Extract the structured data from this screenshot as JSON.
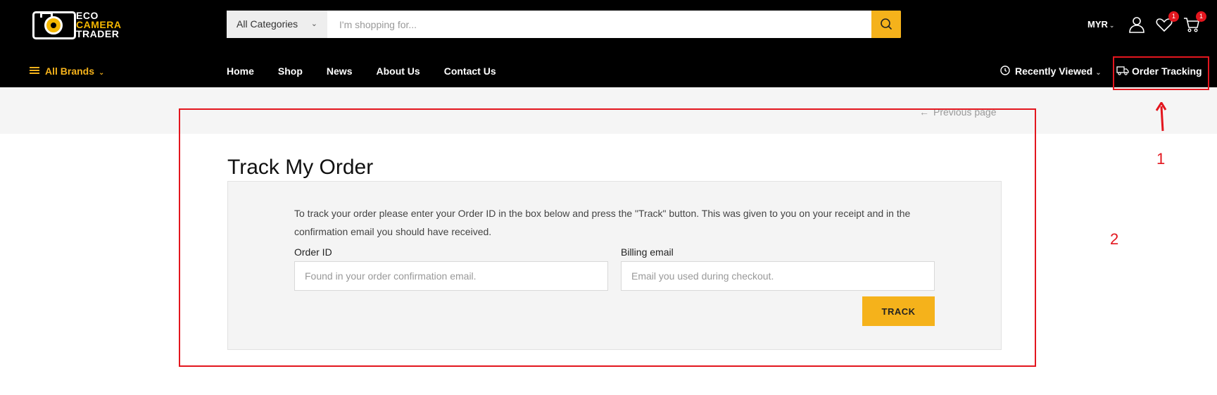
{
  "logo": {
    "line1": "ECO",
    "line2": "CAMERA",
    "line3": "TRADER"
  },
  "search": {
    "category": "All Categories",
    "placeholder": "I'm shopping for..."
  },
  "header": {
    "currency": "MYR",
    "wishlist_count": "1",
    "cart_count": "1"
  },
  "nav": {
    "all_brands": "All Brands",
    "items": [
      "Home",
      "Shop",
      "News",
      "About Us",
      "Contact Us"
    ],
    "recently_viewed": "Recently Viewed",
    "order_tracking": "Order Tracking"
  },
  "annotations": {
    "one": "1",
    "two": "2"
  },
  "page": {
    "previous": "Previous page",
    "title": "Track My Order",
    "description": "To track your order please enter your Order ID in the box below and press the \"Track\" button. This was given to you on your receipt and in the confirmation email you should have received.",
    "order_id_label": "Order ID",
    "order_id_placeholder": "Found in your order confirmation email.",
    "email_label": "Billing email",
    "email_placeholder": "Email you used during checkout.",
    "track_button": "TRACK"
  },
  "colors": {
    "accent": "#f5b21b",
    "header_bg": "#000000",
    "annotation": "#e3161e"
  }
}
